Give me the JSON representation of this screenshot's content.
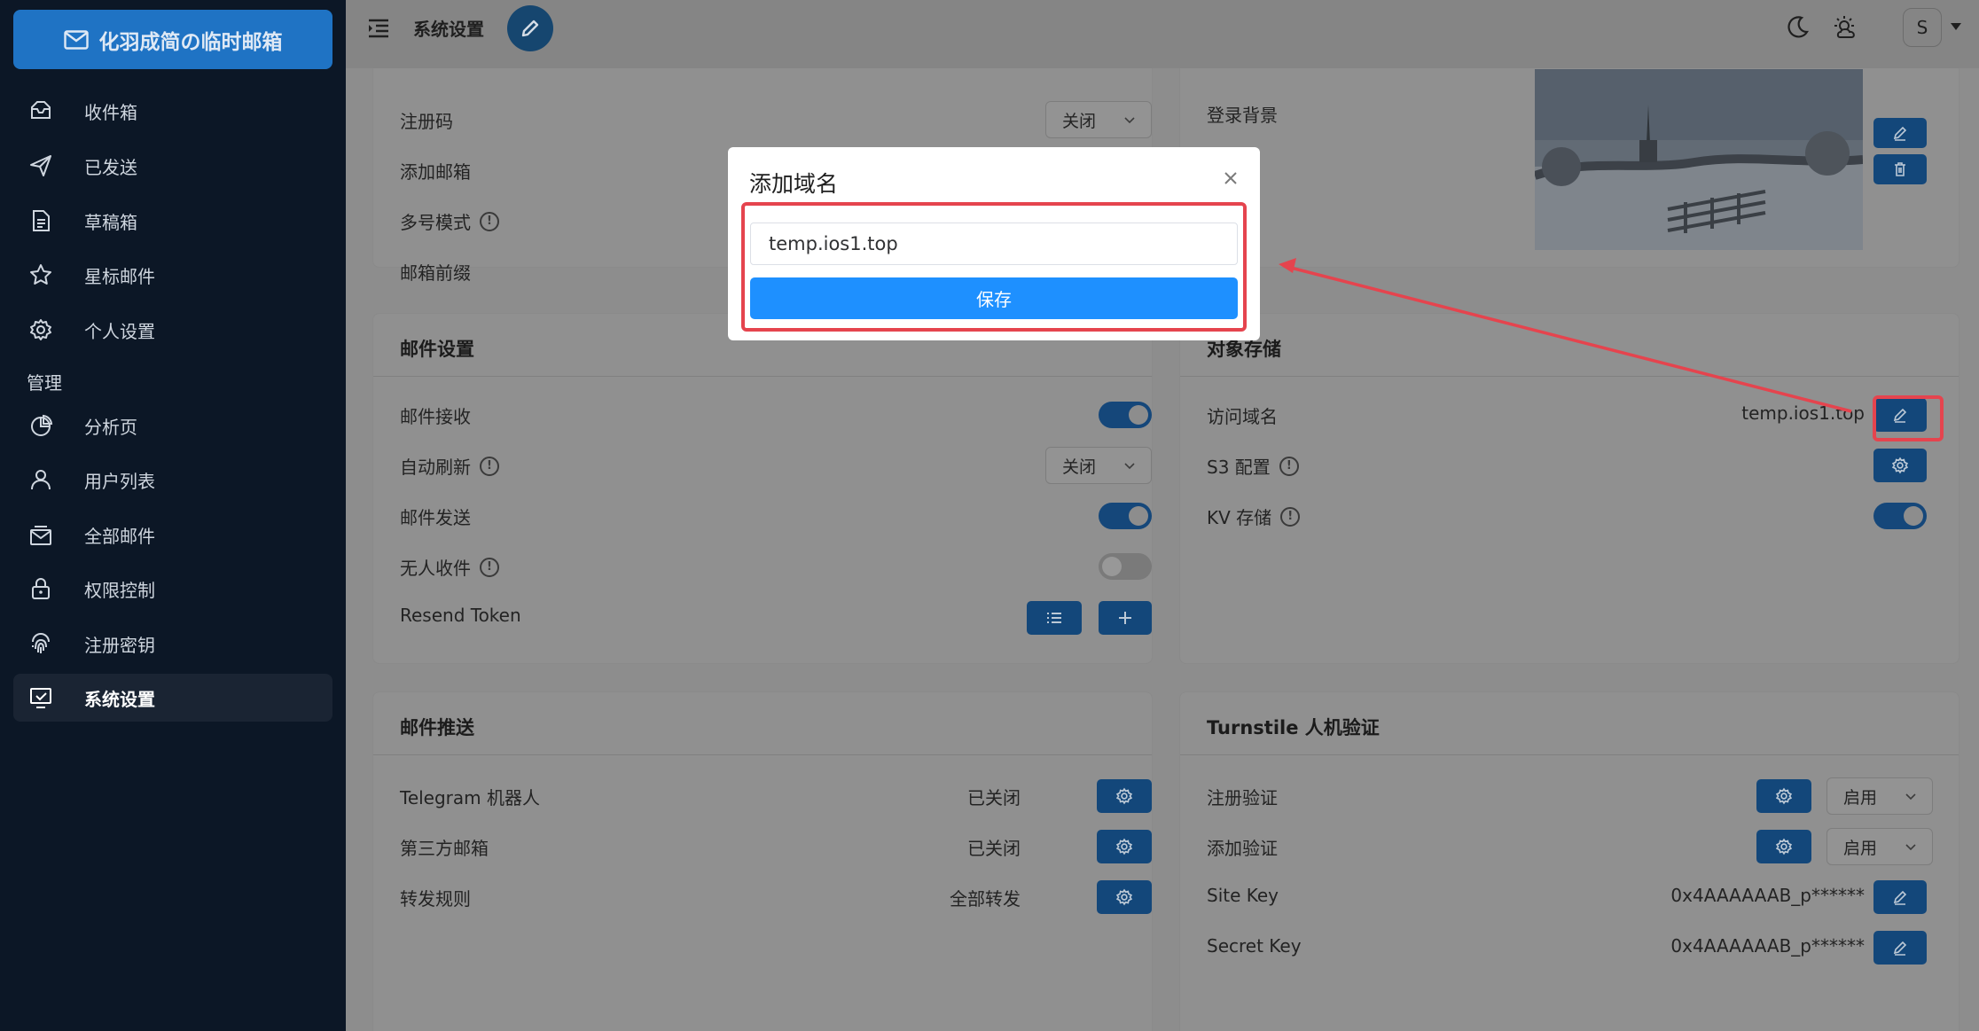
{
  "app": {
    "logo_text": "化羽成简の临时邮箱"
  },
  "sidebar": {
    "items": [
      {
        "label": "收件箱",
        "icon": "inbox-icon"
      },
      {
        "label": "已发送",
        "icon": "send-icon"
      },
      {
        "label": "草稿箱",
        "icon": "draft-icon"
      },
      {
        "label": "星标邮件",
        "icon": "star-icon"
      },
      {
        "label": "个人设置",
        "icon": "gear-icon"
      }
    ],
    "section_label": "管理",
    "admin_items": [
      {
        "label": "分析页",
        "icon": "pie-chart-icon"
      },
      {
        "label": "用户列表",
        "icon": "user-icon"
      },
      {
        "label": "全部邮件",
        "icon": "mail-stack-icon"
      },
      {
        "label": "权限控制",
        "icon": "lock-icon"
      },
      {
        "label": "注册密钥",
        "icon": "fingerprint-icon"
      },
      {
        "label": "系统设置",
        "icon": "monitor-check-icon",
        "active": true
      }
    ]
  },
  "header": {
    "title": "系统设置",
    "avatar_letter": "S"
  },
  "account_card": {
    "rows": [
      {
        "label": "注册码",
        "select": "关闭"
      },
      {
        "label": "添加邮箱"
      },
      {
        "label": "多号模式"
      },
      {
        "label": "邮箱前缀"
      }
    ]
  },
  "login_card": {
    "label": "登录背景"
  },
  "mail_settings": {
    "title": "邮件设置",
    "rows": [
      {
        "label": "邮件接收"
      },
      {
        "label": "自动刷新",
        "select": "关闭"
      },
      {
        "label": "邮件发送"
      },
      {
        "label": "无人收件"
      },
      {
        "label": "Resend Token"
      }
    ]
  },
  "object_storage": {
    "title": "对象存储",
    "rows": [
      {
        "label": "访问域名",
        "value": "temp.ios1.top"
      },
      {
        "label": "S3 配置"
      },
      {
        "label": "KV 存储"
      }
    ]
  },
  "mail_push": {
    "title": "邮件推送",
    "rows": [
      {
        "label": "Telegram 机器人",
        "value": "已关闭"
      },
      {
        "label": "第三方邮箱",
        "value": "已关闭"
      },
      {
        "label": "转发规则",
        "value": "全部转发"
      }
    ]
  },
  "turnstile": {
    "title": "Turnstile 人机验证",
    "rows": [
      {
        "label": "注册验证",
        "select": "启用"
      },
      {
        "label": "添加验证",
        "select": "启用"
      },
      {
        "label": "Site Key",
        "value": "0x4AAAAAAB_p******"
      },
      {
        "label": "Secret Key",
        "value": "0x4AAAAAAB_p******"
      }
    ]
  },
  "modal": {
    "title": "添加域名",
    "input_value": "temp.ios1.top",
    "save_label": "保存"
  },
  "colors": {
    "accent": "#1e90ff",
    "highlight": "#e5444e",
    "sidebar_bg": "#0c1726"
  }
}
